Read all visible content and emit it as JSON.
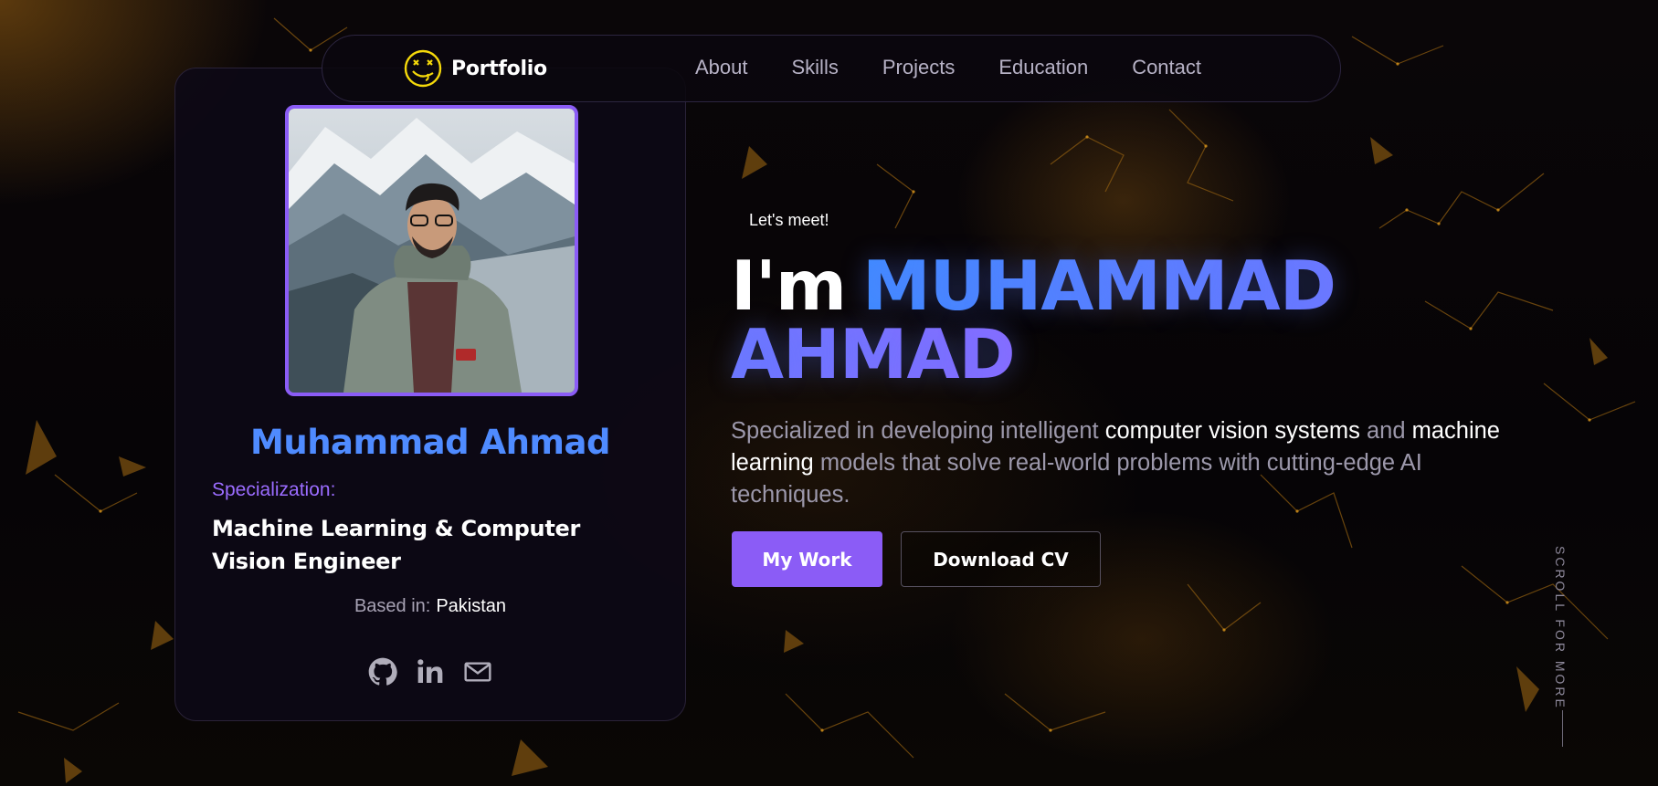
{
  "nav": {
    "brand": "Portfolio",
    "brand_icon": "smiley-face-logo-icon",
    "links": [
      "About",
      "Skills",
      "Projects",
      "Education",
      "Contact"
    ]
  },
  "profile": {
    "name": "Muhammad Ahmad",
    "specialization_label": "Specialization:",
    "specialization": "Machine Learning & Computer Vision Engineer",
    "based_label": "Based in:",
    "based_value": "Pakistan",
    "socials": [
      "github-icon",
      "linkedin-icon",
      "mail-icon"
    ]
  },
  "hero": {
    "eyebrow": "Let's meet!",
    "greeting": "I'm",
    "name": "MUHAMMAD AHMAD",
    "description": {
      "part1": "Specialized in developing intelligent ",
      "strong1": "computer vision systems",
      "part2": " and ",
      "strong2": "machine learning",
      "part3": " models that solve real-world problems with cutting-edge AI techniques."
    },
    "primary_button": "My Work",
    "secondary_button": "Download CV"
  },
  "scroll_hint": "SCROLL FOR MORE",
  "colors": {
    "accent_purple": "#8b5cf6",
    "accent_blue": "#4f8bff",
    "background": "#050308",
    "brand_yellow": "#f5d90a"
  }
}
